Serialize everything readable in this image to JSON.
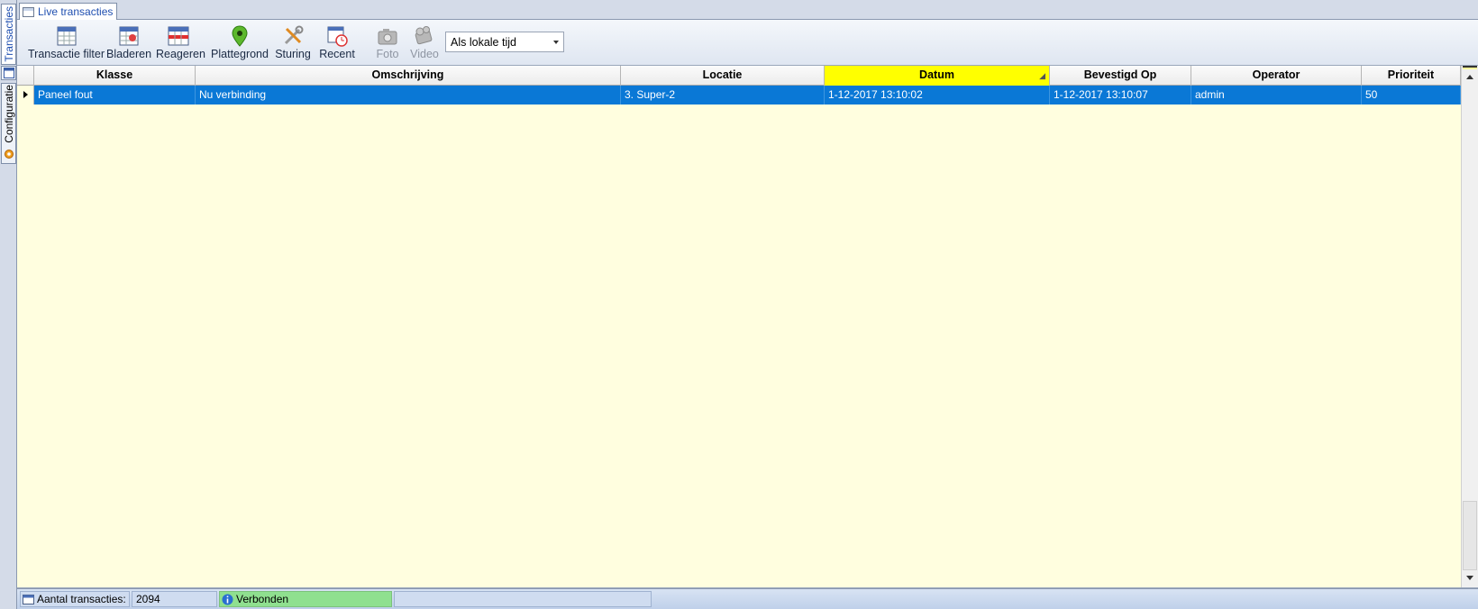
{
  "side_tabs": [
    {
      "label": "Transacties",
      "icon": "table-icon",
      "active": true
    },
    {
      "label": "Configuratie",
      "icon": "gear-icon",
      "active": false
    }
  ],
  "document_tab": {
    "label": "Live transacties",
    "icon": "window-icon"
  },
  "toolbar": {
    "buttons": [
      {
        "label": "Transactie filter",
        "icon": "filter-table-icon",
        "enabled": true
      },
      {
        "label": "Bladeren",
        "icon": "browse-table-icon",
        "enabled": true
      },
      {
        "label": "Reageren",
        "icon": "respond-table-icon",
        "enabled": true
      },
      {
        "label": "Plattegrond",
        "icon": "map-pin-icon",
        "enabled": true
      },
      {
        "label": "Sturing",
        "icon": "tools-icon",
        "enabled": true
      },
      {
        "label": "Recent",
        "icon": "recent-clock-icon",
        "enabled": true
      },
      {
        "label": "Foto",
        "icon": "camera-icon",
        "enabled": false
      },
      {
        "label": "Video",
        "icon": "video-camera-icon",
        "enabled": false
      }
    ],
    "time_mode": {
      "value": "Als lokale tijd"
    }
  },
  "grid": {
    "columns": [
      "Klasse",
      "Omschrijving",
      "Locatie",
      "Datum",
      "Bevestigd Op",
      "Operator",
      "Prioriteit"
    ],
    "sorted_column": "Datum",
    "rows": [
      {
        "selected": true,
        "cells": [
          "Paneel fout",
          "Nu verbinding",
          "3. Super-2",
          "1-12-2017 13:10:02",
          "1-12-2017 13:10:07",
          "admin",
          "50"
        ]
      }
    ]
  },
  "statusbar": {
    "count_label": "Aantal transacties:",
    "count_value": "2094",
    "connection_status": "Verbonden"
  },
  "colors": {
    "selection": "#0a78d6",
    "grid_background": "#fffedf",
    "sorted_header": "#ffff00",
    "connected": "#8fe08f"
  }
}
